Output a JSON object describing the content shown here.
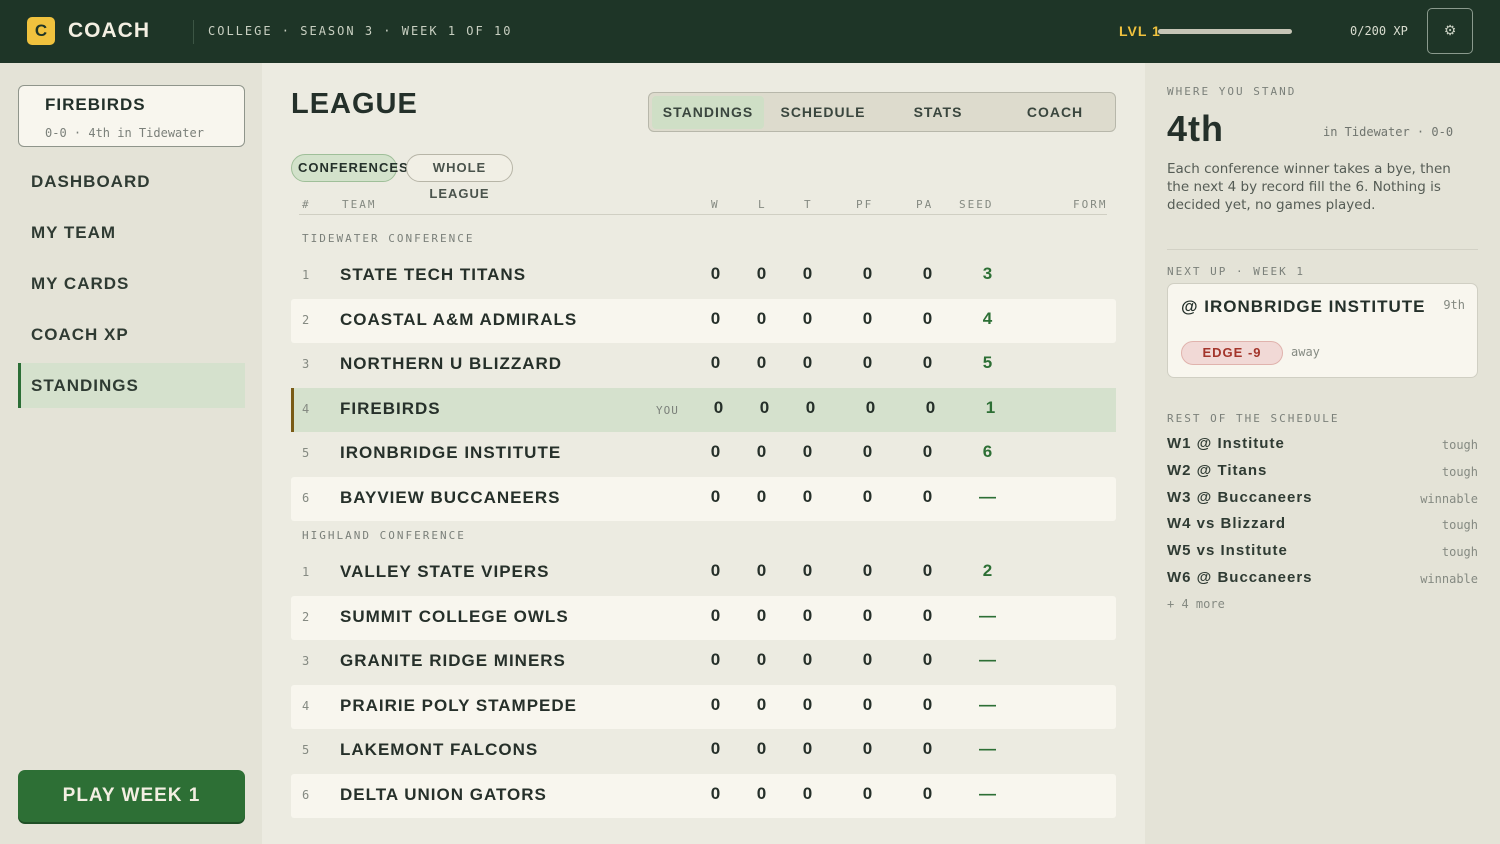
{
  "topbar": {
    "logo_letter": "C",
    "app_name": "COACH",
    "breadcrumb": "COLLEGE · SEASON 3 · WEEK 1 OF 10",
    "level_label": "LVL 1",
    "xp_text": "0/200 XP",
    "xp_progress": 0,
    "settings_icon": "⚙"
  },
  "sidebar": {
    "team_name": "FIREBIRDS",
    "team_sub": "0-0 · 4th in Tidewater",
    "nav": [
      "DASHBOARD",
      "MY TEAM",
      "MY CARDS",
      "COACH XP",
      "STANDINGS"
    ],
    "active_nav": "STANDINGS",
    "play_button": "PLAY WEEK 1"
  },
  "main": {
    "title": "LEAGUE",
    "tabs": [
      "STANDINGS",
      "SCHEDULE",
      "STATS",
      "COACH"
    ],
    "active_tab": "STANDINGS",
    "view_chips": [
      "CONFERENCES",
      "WHOLE LEAGUE"
    ],
    "active_chip": "CONFERENCES",
    "columns": [
      "#",
      "TEAM",
      "W",
      "L",
      "T",
      "PF",
      "PA",
      "SEED",
      "FORM"
    ],
    "you_tag": "YOU",
    "conferences": [
      {
        "name": "TIDEWATER CONFERENCE",
        "rows": [
          {
            "rank": "1",
            "team": "STATE TECH TITANS",
            "w": "0",
            "l": "0",
            "t": "0",
            "pf": "0",
            "pa": "0",
            "seed": "3"
          },
          {
            "rank": "2",
            "team": "COASTAL A&M ADMIRALS",
            "w": "0",
            "l": "0",
            "t": "0",
            "pf": "0",
            "pa": "0",
            "seed": "4"
          },
          {
            "rank": "3",
            "team": "NORTHERN U BLIZZARD",
            "w": "0",
            "l": "0",
            "t": "0",
            "pf": "0",
            "pa": "0",
            "seed": "5"
          },
          {
            "rank": "4",
            "team": "FIREBIRDS",
            "w": "0",
            "l": "0",
            "t": "0",
            "pf": "0",
            "pa": "0",
            "seed": "1",
            "you": true
          },
          {
            "rank": "5",
            "team": "IRONBRIDGE INSTITUTE",
            "w": "0",
            "l": "0",
            "t": "0",
            "pf": "0",
            "pa": "0",
            "seed": "6"
          },
          {
            "rank": "6",
            "team": "BAYVIEW BUCCANEERS",
            "w": "0",
            "l": "0",
            "t": "0",
            "pf": "0",
            "pa": "0",
            "seed": "—"
          }
        ]
      },
      {
        "name": "HIGHLAND CONFERENCE",
        "rows": [
          {
            "rank": "1",
            "team": "VALLEY STATE VIPERS",
            "w": "0",
            "l": "0",
            "t": "0",
            "pf": "0",
            "pa": "0",
            "seed": "2"
          },
          {
            "rank": "2",
            "team": "SUMMIT COLLEGE OWLS",
            "w": "0",
            "l": "0",
            "t": "0",
            "pf": "0",
            "pa": "0",
            "seed": "—"
          },
          {
            "rank": "3",
            "team": "GRANITE RIDGE MINERS",
            "w": "0",
            "l": "0",
            "t": "0",
            "pf": "0",
            "pa": "0",
            "seed": "—"
          },
          {
            "rank": "4",
            "team": "PRAIRIE POLY STAMPEDE",
            "w": "0",
            "l": "0",
            "t": "0",
            "pf": "0",
            "pa": "0",
            "seed": "—"
          },
          {
            "rank": "5",
            "team": "LAKEMONT FALCONS",
            "w": "0",
            "l": "0",
            "t": "0",
            "pf": "0",
            "pa": "0",
            "seed": "—"
          },
          {
            "rank": "6",
            "team": "DELTA UNION GATORS",
            "w": "0",
            "l": "0",
            "t": "0",
            "pf": "0",
            "pa": "0",
            "seed": "—"
          }
        ]
      }
    ]
  },
  "right": {
    "stand_label": "WHERE YOU STAND",
    "rank": "4th",
    "rank_sub": "in Tidewater · 0-0",
    "description": "Each conference winner takes a bye, then the next 4 by record fill the 6. Nothing is decided yet, no games played.",
    "next_label": "NEXT UP · WEEK 1",
    "next_opponent": "@ IRONBRIDGE INSTITUTE",
    "next_opponent_rank": "9th",
    "edge": "EDGE -9",
    "location": "away",
    "rest_label": "REST OF THE SCHEDULE",
    "schedule": [
      {
        "game": "W1 @ Institute",
        "difficulty": "tough"
      },
      {
        "game": "W2 @ Titans",
        "difficulty": "tough"
      },
      {
        "game": "W3 @ Buccaneers",
        "difficulty": "winnable"
      },
      {
        "game": "W4 vs Blizzard",
        "difficulty": "tough"
      },
      {
        "game": "W5 vs Institute",
        "difficulty": "tough"
      },
      {
        "game": "W6 @ Buccaneers",
        "difficulty": "winnable"
      }
    ],
    "more": "+ 4 more"
  },
  "colors": {
    "topbar": "#1e3527",
    "accent_green": "#2d6f35",
    "accent_yellow": "#f0c23e",
    "edge_red": "#a3352b"
  }
}
